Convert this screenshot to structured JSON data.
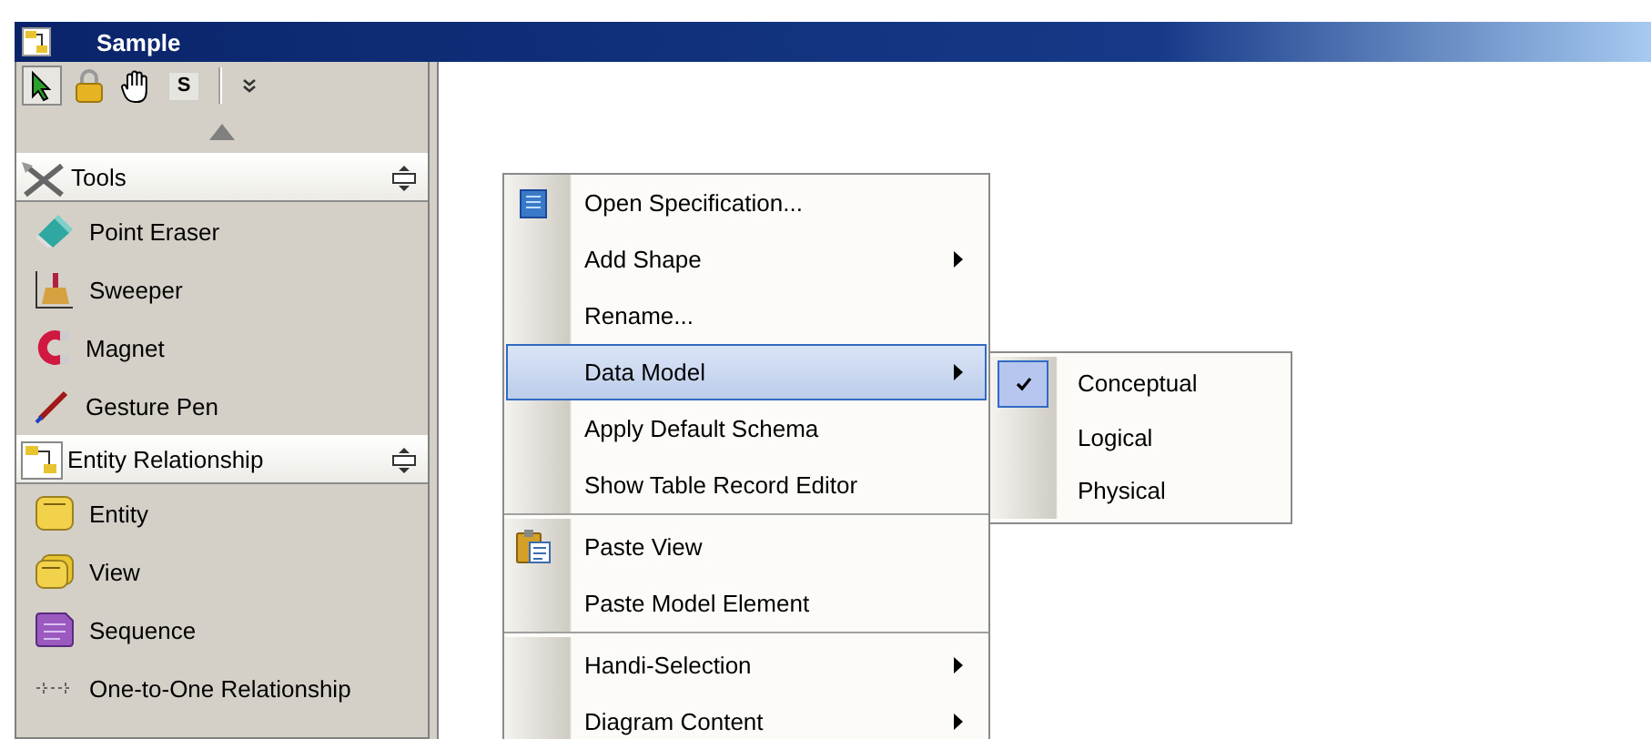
{
  "window": {
    "title": "Sample"
  },
  "toolbar": [
    {
      "kind": "pointer",
      "selected": true
    },
    {
      "kind": "lock",
      "selected": false
    },
    {
      "kind": "hand",
      "selected": false
    },
    {
      "kind": "letter",
      "label": "S",
      "selected": false
    },
    {
      "kind": "more",
      "selected": false
    }
  ],
  "palette": [
    {
      "title": "Tools",
      "items": [
        {
          "label": "Point Eraser"
        },
        {
          "label": "Sweeper"
        },
        {
          "label": "Magnet"
        },
        {
          "label": "Gesture Pen"
        }
      ]
    },
    {
      "title": "Entity Relationship",
      "items": [
        {
          "label": "Entity"
        },
        {
          "label": "View"
        },
        {
          "label": "Sequence"
        },
        {
          "label": "One-to-One Relationship"
        }
      ]
    }
  ],
  "context_menu": {
    "items": [
      {
        "kind": "item",
        "label": "Open Specification...",
        "submenu": false,
        "selected": false
      },
      {
        "kind": "item",
        "label": "Add Shape",
        "submenu": true,
        "selected": false
      },
      {
        "kind": "item",
        "label": "Rename...",
        "submenu": false,
        "selected": false
      },
      {
        "kind": "item",
        "label": "Data Model",
        "submenu": true,
        "selected": true
      },
      {
        "kind": "item",
        "label": "Apply Default Schema",
        "submenu": false,
        "selected": false
      },
      {
        "kind": "item",
        "label": "Show Table Record Editor",
        "submenu": false,
        "selected": false
      },
      {
        "kind": "separator"
      },
      {
        "kind": "item",
        "label": "Paste View",
        "submenu": false,
        "selected": false
      },
      {
        "kind": "item",
        "label": "Paste Model Element",
        "submenu": false,
        "selected": false
      },
      {
        "kind": "separator"
      },
      {
        "kind": "item",
        "label": "Handi-Selection",
        "submenu": true,
        "selected": false
      },
      {
        "kind": "item",
        "label": "Diagram Content",
        "submenu": true,
        "selected": false
      }
    ]
  },
  "submenu": {
    "items": [
      {
        "label": "Conceptual",
        "checked": true
      },
      {
        "label": "Logical",
        "checked": false
      },
      {
        "label": "Physical",
        "checked": false
      }
    ]
  }
}
